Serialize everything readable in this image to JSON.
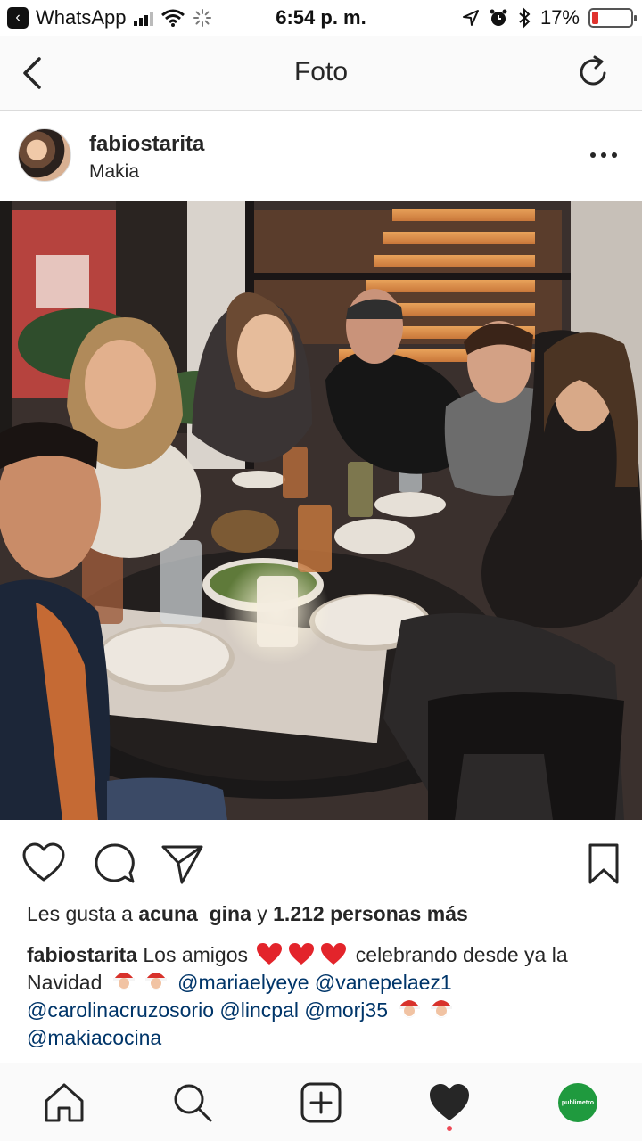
{
  "status_bar": {
    "back_app": "WhatsApp",
    "time": "6:54 p. m.",
    "battery_percent": "17%",
    "battery_level": 0.17,
    "icons": [
      "signal-icon",
      "wifi-icon",
      "activity-spinner-icon",
      "location-arrow-icon",
      "alarm-icon",
      "bluetooth-icon",
      "battery-icon"
    ]
  },
  "nav": {
    "title": "Foto",
    "back_icon": "chevron-left-icon",
    "refresh_icon": "refresh-icon"
  },
  "post": {
    "username": "fabiostarita",
    "location": "Makia",
    "more_icon": "more-horizontal-icon",
    "photo_description_icon": "photo"
  },
  "actions": {
    "like_icon": "heart-outline-icon",
    "comment_icon": "comment-icon",
    "share_icon": "send-icon",
    "save_icon": "bookmark-icon"
  },
  "likes": {
    "prefix": "Les gusta a ",
    "user": "acuna_gina",
    "middle": " y ",
    "count": "1.212 personas más"
  },
  "caption": {
    "user": "fabiostarita",
    "text_1": " Los amigos ",
    "text_2": " celebrando desde ya la Navidad ",
    "mentions": [
      "@mariaelyeye",
      "@vanepelaez1",
      "@carolinacruzosorio",
      "@lincpal",
      "@morj35",
      "@makiacocina"
    ],
    "emoji_hearts": "heart-emoji",
    "emoji_santa": "santa-emoji"
  },
  "tab_bar": {
    "home_icon": "home-icon",
    "search_icon": "search-icon",
    "add_icon": "add-post-icon",
    "activity_icon": "heart-filled-icon",
    "profile_label": "publimetro"
  },
  "colors": {
    "mention": "#003569",
    "heart_emoji": "#e3242b",
    "notification_dot": "#ed4956",
    "profile_badge": "#1f9a3e"
  }
}
